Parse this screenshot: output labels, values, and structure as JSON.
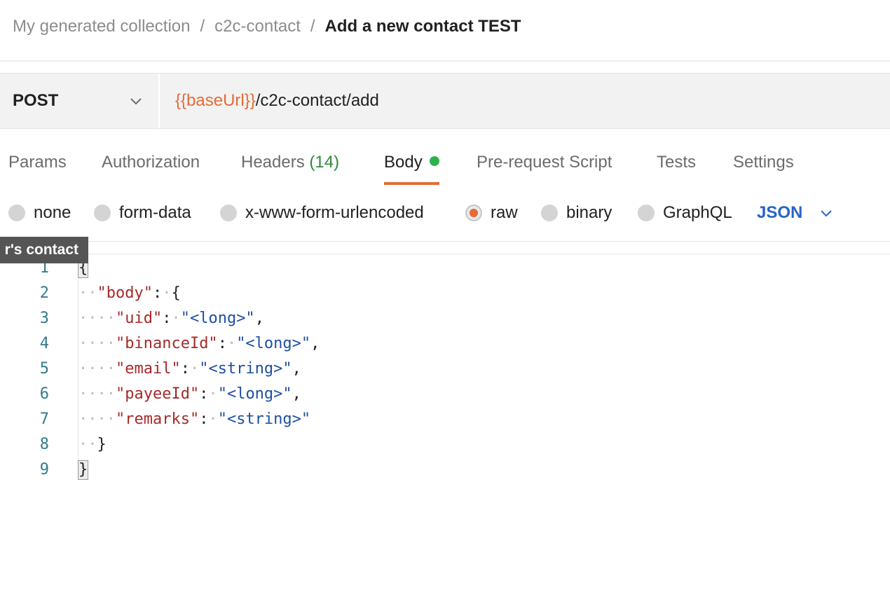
{
  "breadcrumb": {
    "collection": "My generated collection",
    "folder": "c2c-contact",
    "current": "Add a new contact TEST",
    "separator": "/"
  },
  "request": {
    "method": "POST",
    "url_variable": "{{baseUrl}}",
    "url_path": "/c2c-contact/add"
  },
  "tabs": {
    "params": "Params",
    "authorization": "Authorization",
    "headers": "Headers",
    "headers_count": "(14)",
    "body": "Body",
    "prerequest": "Pre-request Script",
    "tests": "Tests",
    "settings": "Settings",
    "active": "Body"
  },
  "body_types": {
    "none": "none",
    "form_data": "form-data",
    "urlencoded": "x-www-form-urlencoded",
    "raw": "raw",
    "binary": "binary",
    "graphql": "GraphQL",
    "selected": "raw",
    "format": "JSON"
  },
  "tooltip": "r's contact",
  "editor": {
    "line_numbers": [
      "1",
      "2",
      "3",
      "4",
      "5",
      "6",
      "7",
      "8",
      "9"
    ],
    "tokens": {
      "open_brace": "{",
      "close_brace": "}",
      "colon": ":",
      "comma": ",",
      "key_body": "\"body\"",
      "key_uid": "\"uid\"",
      "key_binanceId": "\"binanceId\"",
      "key_email": "\"email\"",
      "key_payeeId": "\"payeeId\"",
      "key_remarks": "\"remarks\"",
      "val_long": "\"<long>\"",
      "val_string": "\"<string>\"",
      "ws1": "·",
      "ws2": "··",
      "ws4": "····"
    }
  },
  "colors": {
    "accent": "#e46c36",
    "active_dot": "#2eb24a",
    "format_link": "#2765c5",
    "json_key": "#a52a2a",
    "json_string": "#1e4f9f",
    "line_number": "#337a8c"
  }
}
